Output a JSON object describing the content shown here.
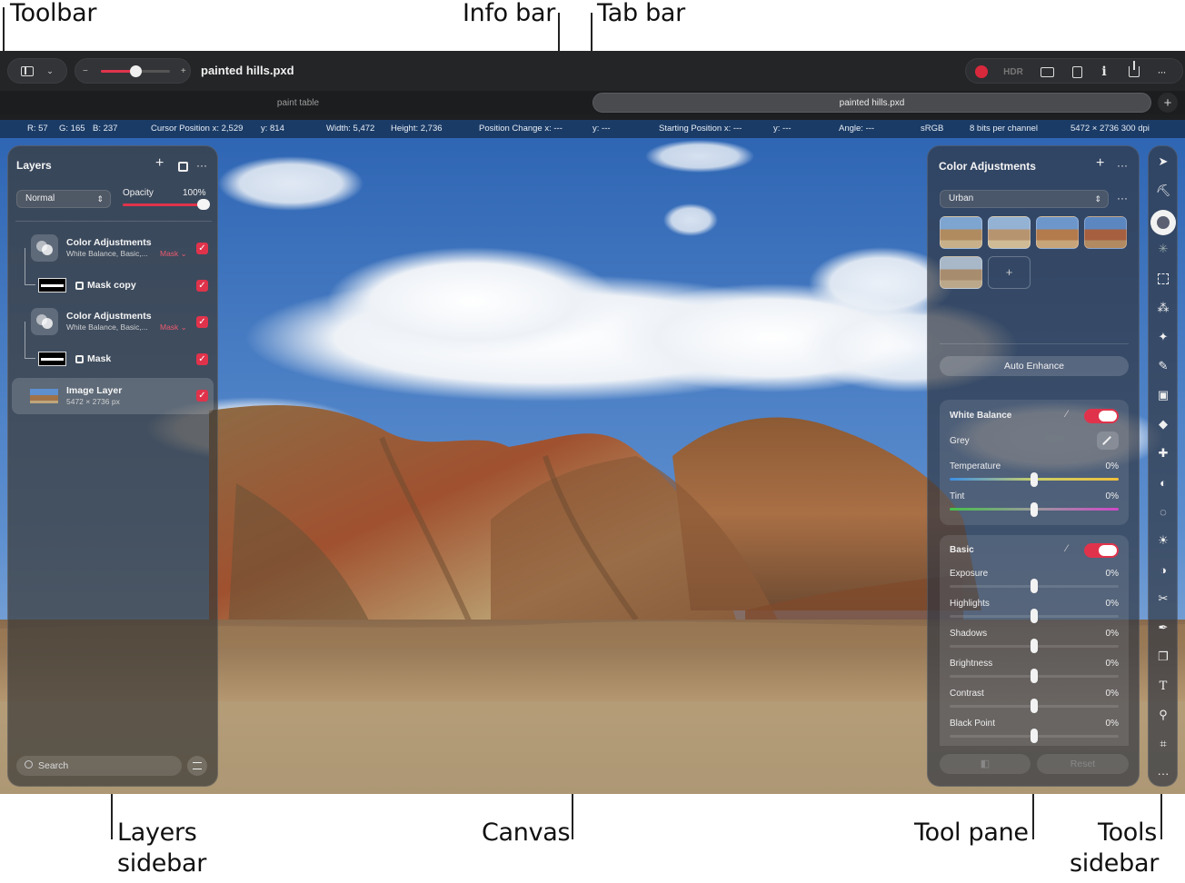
{
  "callouts": {
    "toolbar": "Toolbar",
    "info_bar": "Info bar",
    "tab_bar": "Tab bar",
    "layers_sidebar_1": "Layers",
    "layers_sidebar_2": "sidebar",
    "canvas": "Canvas",
    "tool_pane": "Tool pane",
    "tools_sidebar_1": "Tools",
    "tools_sidebar_2": "sidebar"
  },
  "toolbar": {
    "document_title": "painted hills.pxd",
    "zoom_minus": "−",
    "zoom_plus": "+",
    "zoom_level": 0.5,
    "hdr_label": "HDR",
    "info_glyph": "i",
    "more_glyph": "···"
  },
  "tabs": [
    {
      "label": "paint table",
      "active": false
    },
    {
      "label": "painted hills.pxd",
      "active": true
    }
  ],
  "new_tab_glyph": "+",
  "info_bar": {
    "r": "R: 57",
    "g": "G: 165",
    "b": "B: 237",
    "cursor_x": "Cursor Position x: 2,529",
    "cursor_y": "y: 814",
    "width": "Width: 5,472",
    "height": "Height: 2,736",
    "pos_change_x": "Position Change x: ---",
    "pos_change_y": "y: ---",
    "start_x": "Starting Position x: ---",
    "start_y": "y: ---",
    "angle": "Angle: ---",
    "color_space": "sRGB",
    "bits": "8 bits per channel",
    "dimensions": "5472 × 2736 300 dpi"
  },
  "layers": {
    "title": "Layers",
    "add_glyph": "+",
    "more_glyph": "···",
    "blend_mode": "Normal",
    "opacity_label": "Opacity",
    "opacity_value": "100%",
    "items": [
      {
        "name": "Color Adjustments",
        "sub": "White Balance, Basic,...",
        "badge": "Mask ⌄",
        "checked": true
      },
      {
        "name": "Mask copy",
        "sub": "",
        "badge": "",
        "checked": true
      },
      {
        "name": "Color Adjustments",
        "sub": "White Balance, Basic,...",
        "badge": "Mask ⌄",
        "checked": true
      },
      {
        "name": "Mask",
        "sub": "",
        "badge": "",
        "checked": true
      },
      {
        "name": "Image Layer",
        "sub": "5472 × 2736 px",
        "badge": "",
        "checked": true
      }
    ],
    "search_placeholder": "Search"
  },
  "tool_pane": {
    "title": "Color Adjustments",
    "add_glyph": "+",
    "more_glyph": "···",
    "preset": "Urban",
    "add_preset_glyph": "+",
    "auto_enhance": "Auto Enhance",
    "white_balance": {
      "title": "White Balance",
      "enabled": true,
      "grey_label": "Grey",
      "temperature_label": "Temperature",
      "temperature_value": "0%",
      "tint_label": "Tint",
      "tint_value": "0%"
    },
    "basic": {
      "title": "Basic",
      "enabled": true,
      "rows": [
        {
          "label": "Exposure",
          "value": "0%"
        },
        {
          "label": "Highlights",
          "value": "0%"
        },
        {
          "label": "Shadows",
          "value": "0%"
        },
        {
          "label": "Brightness",
          "value": "0%"
        },
        {
          "label": "Contrast",
          "value": "0%"
        },
        {
          "label": "Black Point",
          "value": "0%"
        }
      ]
    },
    "compare_glyph": "◧",
    "reset": "Reset"
  },
  "tools": [
    "arrange-icon",
    "paint-bucket-icon",
    "color-adjust-icon",
    "sparkle-icon",
    "selection-icon",
    "magic-wand-icon",
    "quick-select-icon",
    "paint-brush-icon",
    "fill-icon",
    "eraser-icon",
    "repair-icon",
    "clone-icon",
    "blur-icon",
    "light-icon",
    "burn-icon",
    "retouch-icon",
    "pen-icon",
    "shape-icon",
    "type-icon",
    "zoom-icon",
    "crop-icon",
    "more-icon"
  ],
  "colors": {
    "accent": "#e0334b",
    "info_bar": "#1a3b66",
    "toolbar": "#242527"
  }
}
